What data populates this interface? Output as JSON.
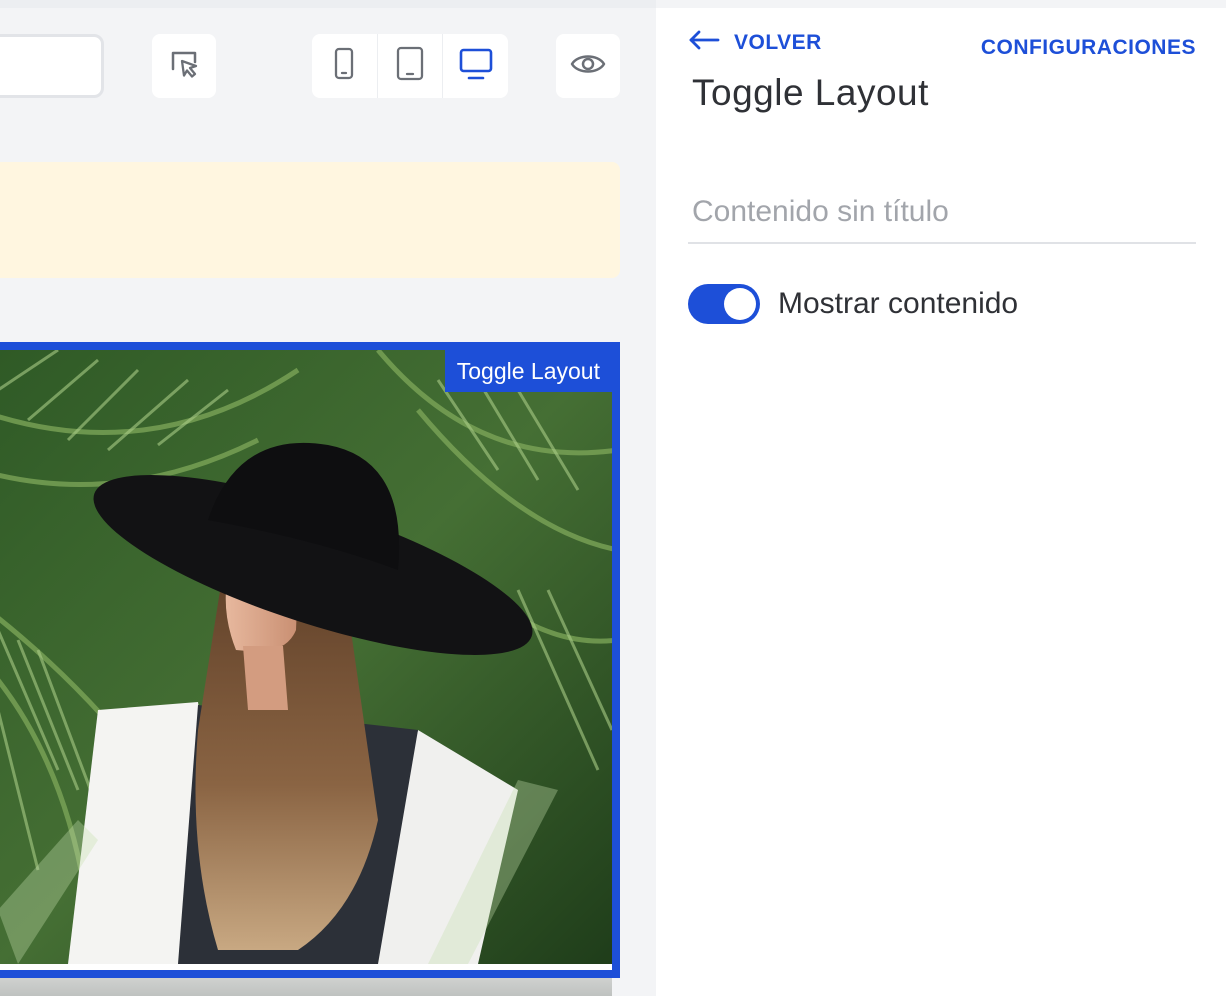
{
  "toolbar": {
    "select_tool_icon": "cursor-select-icon",
    "device_buttons": [
      {
        "icon": "mobile-icon",
        "active": false
      },
      {
        "icon": "tablet-icon",
        "active": false
      },
      {
        "icon": "desktop-icon",
        "active": true
      }
    ],
    "preview_icon": "eye-icon"
  },
  "canvas": {
    "selected_block_tag": "Toggle Layout",
    "banner_color": "#fff6e0",
    "selection_color": "#1d4fd8"
  },
  "panel": {
    "back_label": "VOLVER",
    "settings_label": "CONFIGURACIONES",
    "title": "Toggle Layout",
    "title_field_placeholder": "Contenido sin título",
    "toggle_label": "Mostrar contenido",
    "toggle_on": true
  },
  "colors": {
    "accent": "#1d4fd8",
    "text": "#2f3136",
    "muted": "#a2a5ab"
  }
}
